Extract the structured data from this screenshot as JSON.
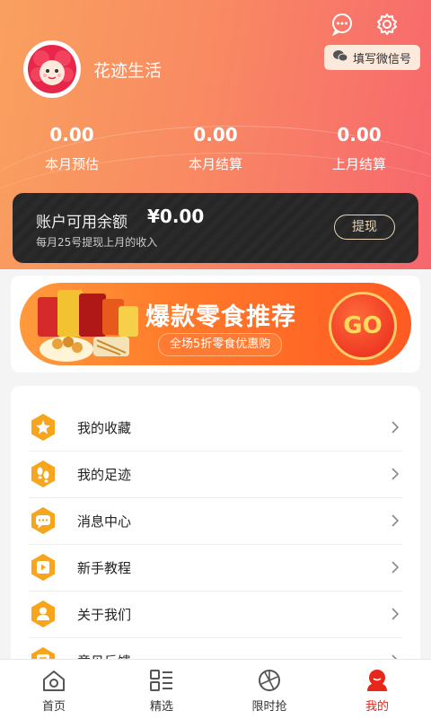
{
  "header": {
    "username": "花迹生活",
    "wechat_button": "填写微信号",
    "stats": [
      {
        "value": "0.00",
        "label": "本月预估"
      },
      {
        "value": "0.00",
        "label": "本月结算"
      },
      {
        "value": "0.00",
        "label": "上月结算"
      }
    ]
  },
  "balance": {
    "label": "账户可用余额",
    "amount": "¥0.00",
    "note": "每月25号提现上月的收入",
    "withdraw_label": "提现"
  },
  "banner": {
    "title": "爆款零食推荐",
    "subtitle": "全场5折零食优惠购",
    "go_label": "GO"
  },
  "menu": {
    "items": [
      {
        "label": "我的收藏",
        "icon": "star-icon"
      },
      {
        "label": "我的足迹",
        "icon": "footprint-icon"
      },
      {
        "label": "消息中心",
        "icon": "message-icon"
      },
      {
        "label": "新手教程",
        "icon": "video-icon"
      },
      {
        "label": "关于我们",
        "icon": "person-icon"
      },
      {
        "label": "意见反馈",
        "icon": "feedback-icon"
      }
    ]
  },
  "tabbar": {
    "tabs": [
      {
        "label": "首页",
        "icon": "home-icon"
      },
      {
        "label": "精选",
        "icon": "grid-list-icon"
      },
      {
        "label": "限时抢",
        "icon": "aperture-icon"
      },
      {
        "label": "我的",
        "icon": "profile-icon"
      }
    ],
    "active_index": 3
  },
  "colors": {
    "accent": "#e8261a",
    "header_start": "#f9a05f",
    "header_end": "#f7666e",
    "icon_bg": "#f7a51c"
  }
}
